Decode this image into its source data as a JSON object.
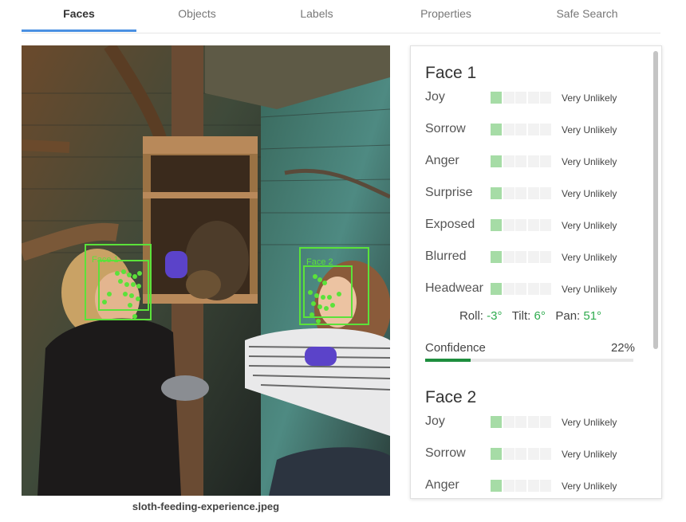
{
  "tabs": [
    {
      "label": "Faces",
      "active": true
    },
    {
      "label": "Objects",
      "active": false
    },
    {
      "label": "Labels",
      "active": false
    },
    {
      "label": "Properties",
      "active": false
    },
    {
      "label": "Safe Search",
      "active": false
    }
  ],
  "image": {
    "filename": "sloth-feeding-experience.jpeg",
    "face_labels": [
      "Face 1",
      "Face 2"
    ],
    "box_color": "#5be23a"
  },
  "faces": [
    {
      "title": "Face 1",
      "attributes": [
        {
          "label": "Joy",
          "value": "Very Unlikely",
          "level": 1
        },
        {
          "label": "Sorrow",
          "value": "Very Unlikely",
          "level": 1
        },
        {
          "label": "Anger",
          "value": "Very Unlikely",
          "level": 1
        },
        {
          "label": "Surprise",
          "value": "Very Unlikely",
          "level": 1
        },
        {
          "label": "Exposed",
          "value": "Very Unlikely",
          "level": 1
        },
        {
          "label": "Blurred",
          "value": "Very Unlikely",
          "level": 1
        },
        {
          "label": "Headwear",
          "value": "Very Unlikely",
          "level": 1
        }
      ],
      "roll_label": "Roll:",
      "roll": "-3°",
      "tilt_label": "Tilt:",
      "tilt": "6°",
      "pan_label": "Pan:",
      "pan": "51°",
      "confidence_label": "Confidence",
      "confidence": "22%",
      "confidence_fraction": 0.22
    },
    {
      "title": "Face 2",
      "attributes": [
        {
          "label": "Joy",
          "value": "Very Unlikely",
          "level": 1
        },
        {
          "label": "Sorrow",
          "value": "Very Unlikely",
          "level": 1
        },
        {
          "label": "Anger",
          "value": "Very Unlikely",
          "level": 1
        }
      ]
    }
  ],
  "colors": {
    "accent_tab": "#4a90e2",
    "likelihood_fill": "#a6dca6",
    "angle_value": "#2eab4e",
    "confidence_fill": "#1e8e3e"
  }
}
